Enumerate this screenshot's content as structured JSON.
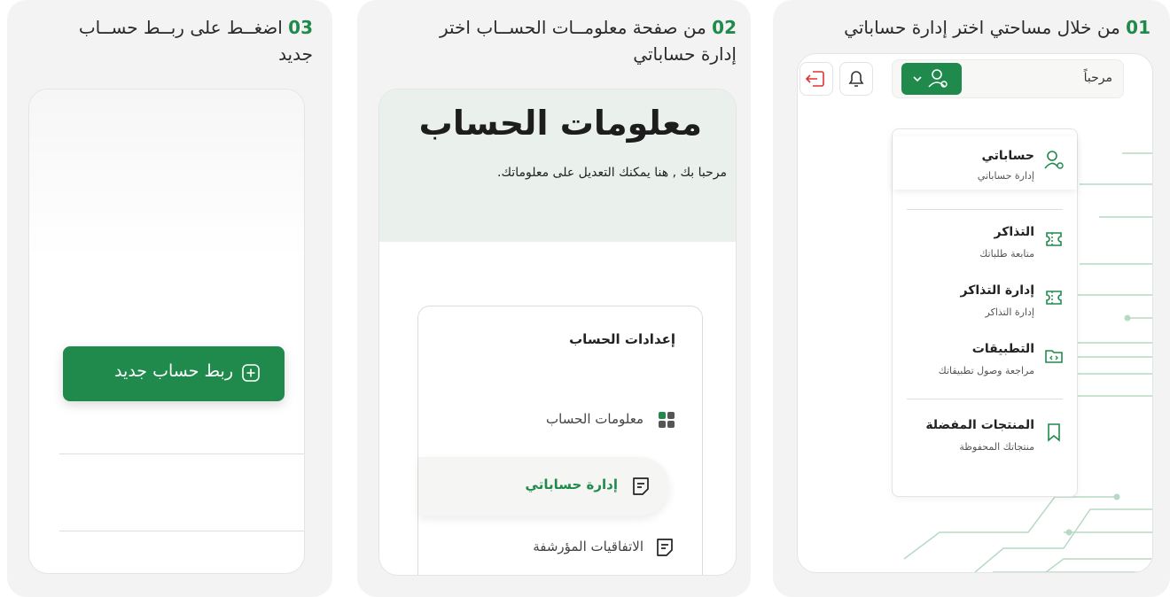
{
  "steps": [
    {
      "number": "01",
      "text": "من خلال مساحتي اختر إدارة حساباتي"
    },
    {
      "number": "02",
      "line1": "من صفحة معلومــات الحســاب اختر",
      "line2": "إدارة حساباتي"
    },
    {
      "number": "03",
      "line1": "اضغــط على ربــط حســاب",
      "line2": "جديد"
    }
  ],
  "topbar": {
    "greeting": "مرحباً"
  },
  "menu": {
    "items": [
      {
        "title": "حساباتي",
        "subtitle": "إدارة حساباتي",
        "icon": "user-settings-icon"
      },
      {
        "title": "التذاكر",
        "subtitle": "متابعة طلباتك",
        "icon": "ticket-icon"
      },
      {
        "title": "إدارة التذاكر",
        "subtitle": "إدارة التذاكر",
        "icon": "ticket-icon"
      },
      {
        "title": "التطبيقات",
        "subtitle": "مراجعة وصول تطبيقاتك",
        "icon": "code-folder-icon"
      },
      {
        "title": "المنتجات المفضلة",
        "subtitle": "منتجاتك المحفوظة",
        "icon": "bookmark-icon"
      }
    ]
  },
  "account_page": {
    "title": "معلومات الحساب",
    "subtitle": "مرحبا بك , هنا يمكنك التعديل على معلوماتك.",
    "settings_title": "إعدادات الحساب",
    "items": [
      {
        "label": "معلومات الحساب",
        "icon": "grid-icon"
      },
      {
        "label": "إدارة حساباتي",
        "icon": "document-icon"
      },
      {
        "label": "الاتفاقيات المؤرشفة",
        "icon": "document-icon"
      }
    ]
  },
  "link_account": {
    "button_label": "ربط حساب جديد"
  },
  "colors": {
    "accent": "#1f8a4c",
    "card_bg": "#f2f3f2",
    "header_bg": "#eaf0ec"
  }
}
